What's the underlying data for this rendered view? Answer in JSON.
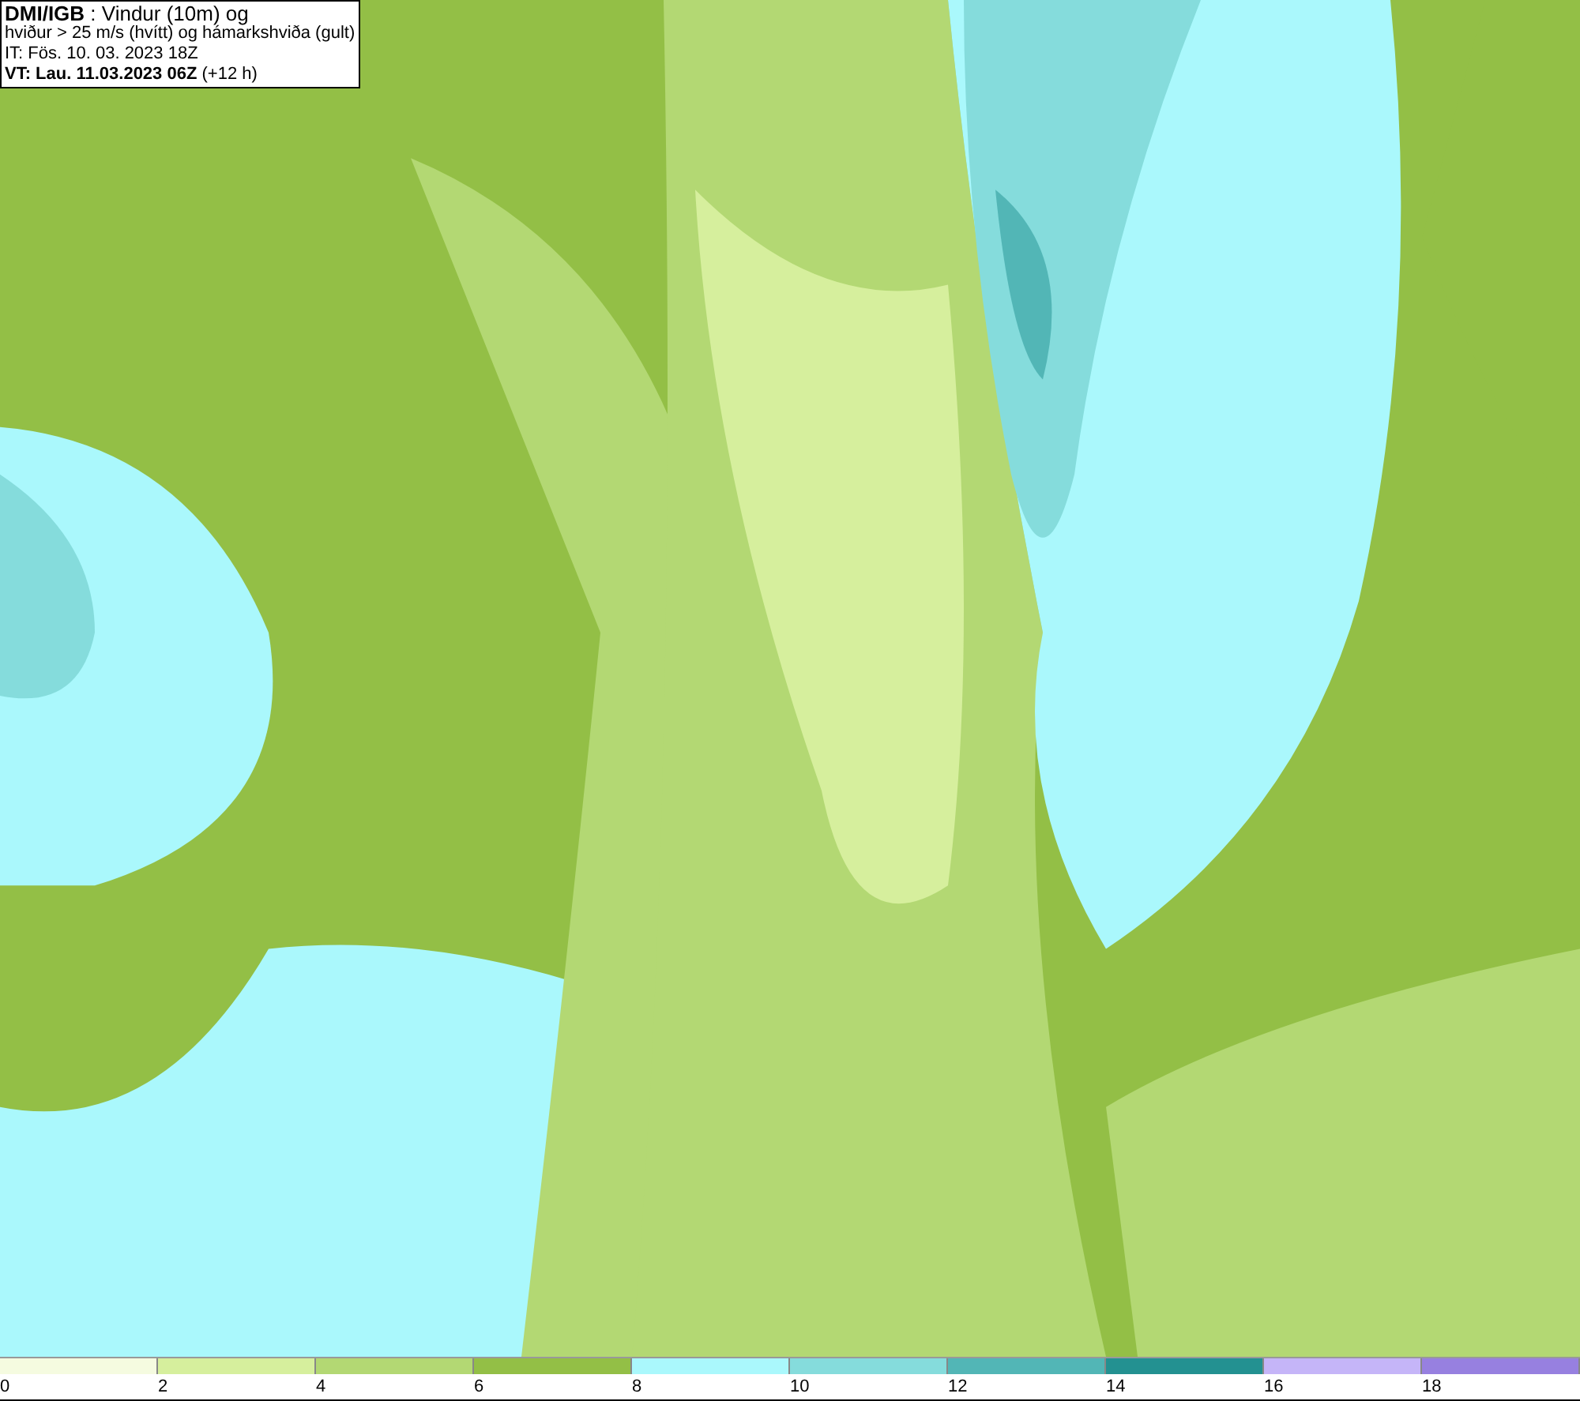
{
  "header": {
    "lines": [
      "**DMI/IGB** : Vindur (10m) og",
      "hviður > 25 m/s (hvítt) og hámarkshviða (gult)",
      "IT: Fös. 10. 03. 2023 18Z",
      "**VT: Lau. 11.03.2023 06Z** (+12 h)"
    ]
  },
  "legend": {
    "bins": [
      {
        "color": "#f5fbe0",
        "label": "0"
      },
      {
        "color": "#d6ef9d",
        "label": "2"
      },
      {
        "color": "#b3d873",
        "label": "4"
      },
      {
        "color": "#93bf46",
        "label": "6"
      },
      {
        "color": "#aaf8fc",
        "label": "8"
      },
      {
        "color": "#85dcdc",
        "label": "10"
      },
      {
        "color": "#52b6b6",
        "label": "12"
      },
      {
        "color": "#239191",
        "label": "14"
      },
      {
        "color": "#c5b5f8",
        "label": "16"
      },
      {
        "color": "#9780e0",
        "label": "18"
      }
    ]
  }
}
